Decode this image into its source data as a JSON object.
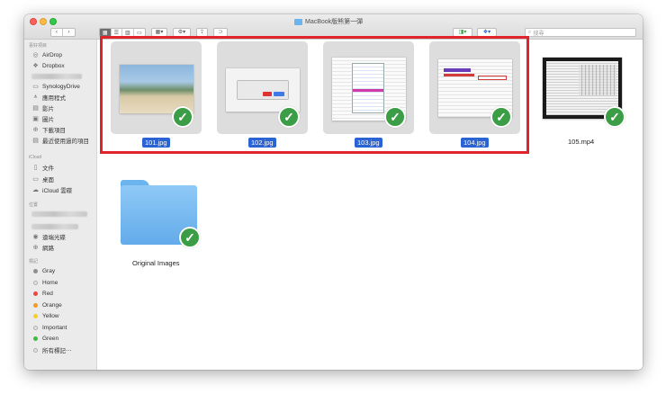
{
  "window": {
    "title": "MacBook版熊第一彈"
  },
  "search": {
    "placeholder": "搜尋"
  },
  "sidebar": {
    "favorites_heading": "喜好項目",
    "favorites": [
      {
        "label": "AirDrop",
        "icon": "airdrop-icon"
      },
      {
        "label": "Dropbox",
        "icon": "dropbox-icon"
      },
      {
        "label": "SynologyDrive",
        "icon": "folder-icon"
      },
      {
        "label": "應用程式",
        "icon": "applications-icon"
      },
      {
        "label": "影片",
        "icon": "movies-icon"
      },
      {
        "label": "圖片",
        "icon": "pictures-icon"
      },
      {
        "label": "下載項目",
        "icon": "downloads-icon"
      },
      {
        "label": "最近使用過的項目",
        "icon": "recents-icon"
      }
    ],
    "icloud_heading": "iCloud",
    "icloud": [
      {
        "label": "文件",
        "icon": "documents-icon"
      },
      {
        "label": "桌面",
        "icon": "desktop-icon"
      },
      {
        "label": "iCloud 雲碟",
        "icon": "icloud-icon"
      }
    ],
    "locations_heading": "位置",
    "locations": [
      {
        "label": "遠端光碟",
        "icon": "disc-icon"
      },
      {
        "label": "網路",
        "icon": "network-icon"
      }
    ],
    "tags_heading": "標記",
    "tags": [
      {
        "label": "Gray",
        "color": "#8e8e8e"
      },
      {
        "label": "Home",
        "color": "#e2e2e2"
      },
      {
        "label": "Red",
        "color": "#f0453b"
      },
      {
        "label": "Orange",
        "color": "#f59a23"
      },
      {
        "label": "Yellow",
        "color": "#f5cf2c"
      },
      {
        "label": "Important",
        "color": "#e2e2e2"
      },
      {
        "label": "Green",
        "color": "#3fbd3e"
      },
      {
        "label": "所有標記⋯",
        "color": "#e2e2e2"
      }
    ]
  },
  "files": [
    {
      "name": "101.jpg",
      "selected": true,
      "checked": true
    },
    {
      "name": "102.jpg",
      "selected": true,
      "checked": true
    },
    {
      "name": "103.jpg",
      "selected": true,
      "checked": true
    },
    {
      "name": "104.jpg",
      "selected": true,
      "checked": true
    },
    {
      "name": "105.mp4",
      "selected": false,
      "checked": true
    },
    {
      "name": "Original Images",
      "selected": false,
      "checked": true
    }
  ],
  "colors": {
    "selection": "#2a63d4",
    "check": "#3b9e46",
    "highlight_frame": "#e0242b",
    "folder": "#6cb4ee"
  }
}
